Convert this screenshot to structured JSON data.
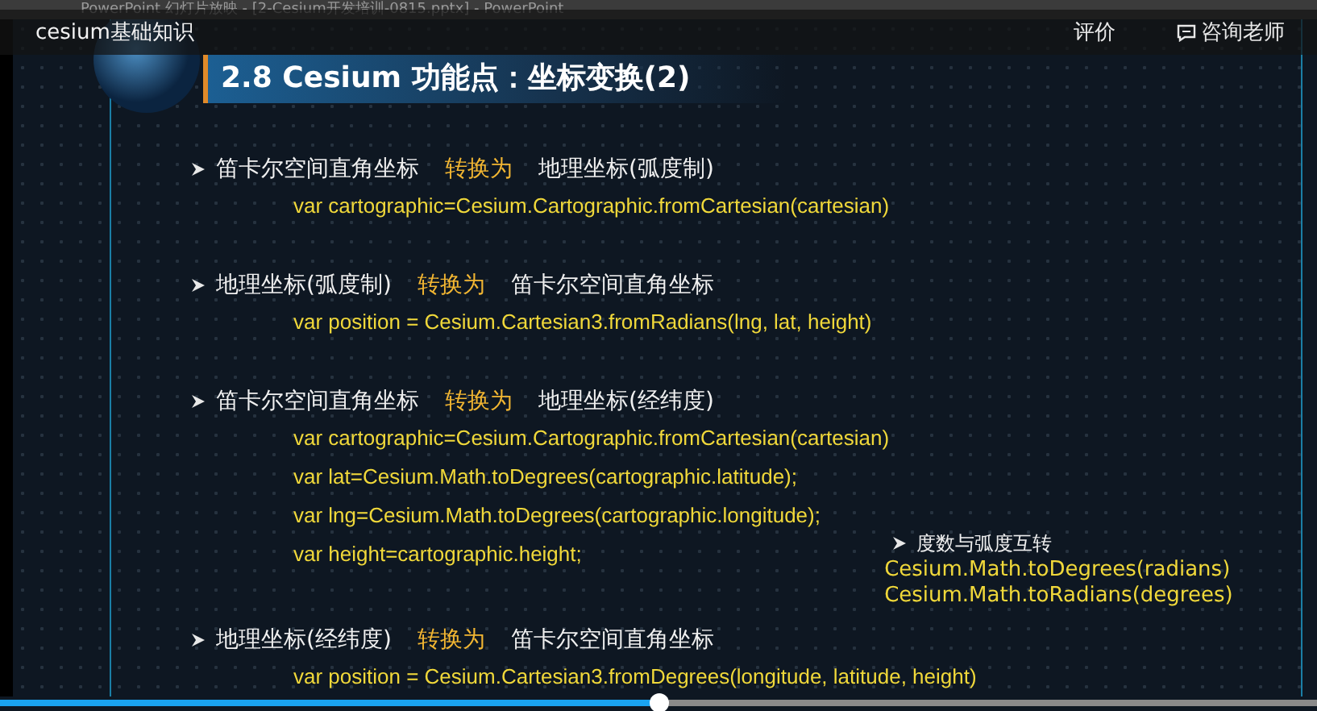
{
  "app_title_bar": {
    "title": "PowerPoint 幻灯片放映 - [2-Cesium开发培训-0815.pptx] - PowerPoint"
  },
  "player": {
    "title": "cesium基础知识",
    "actions": [
      {
        "kind": "text",
        "label": "评价"
      },
      {
        "kind": "consult",
        "label": "咨询老师"
      }
    ]
  },
  "slide": {
    "title": "2.8 Cesium 功能点：坐标变换(2)",
    "sections": [
      {
        "from": "笛卡尔空间直角坐标",
        "verb": "转换为",
        "to": "地理坐标(弧度制)",
        "code": [
          "var cartographic=Cesium.Cartographic.fromCartesian(cartesian)"
        ]
      },
      {
        "from": "地理坐标(弧度制)",
        "verb": "转换为",
        "to": "笛卡尔空间直角坐标",
        "code": [
          "var position = Cesium.Cartesian3.fromRadians(lng, lat, height)"
        ]
      },
      {
        "from": "笛卡尔空间直角坐标",
        "verb": "转换为",
        "to": "地理坐标(经纬度)",
        "code": [
          "var cartographic=Cesium.Cartographic.fromCartesian(cartesian)",
          "var lat=Cesium.Math.toDegrees(cartographic.latitude);",
          "var lng=Cesium.Math.toDegrees(cartographic.longitude);",
          "var height=cartographic.height;"
        ],
        "note": {
          "heading": "度数与弧度互转",
          "lines": [
            "Cesium.Math.toDegrees(radians)",
            "Cesium.Math.toRadians(degrees)"
          ]
        }
      },
      {
        "from": "地理坐标(经纬度)",
        "verb": "转换为",
        "to": "笛卡尔空间直角坐标",
        "code": [
          "var position = Cesium.Cartesian3.fromDegrees(longitude, latitude, height)"
        ]
      }
    ]
  },
  "progress": {
    "level": 0.5
  }
}
